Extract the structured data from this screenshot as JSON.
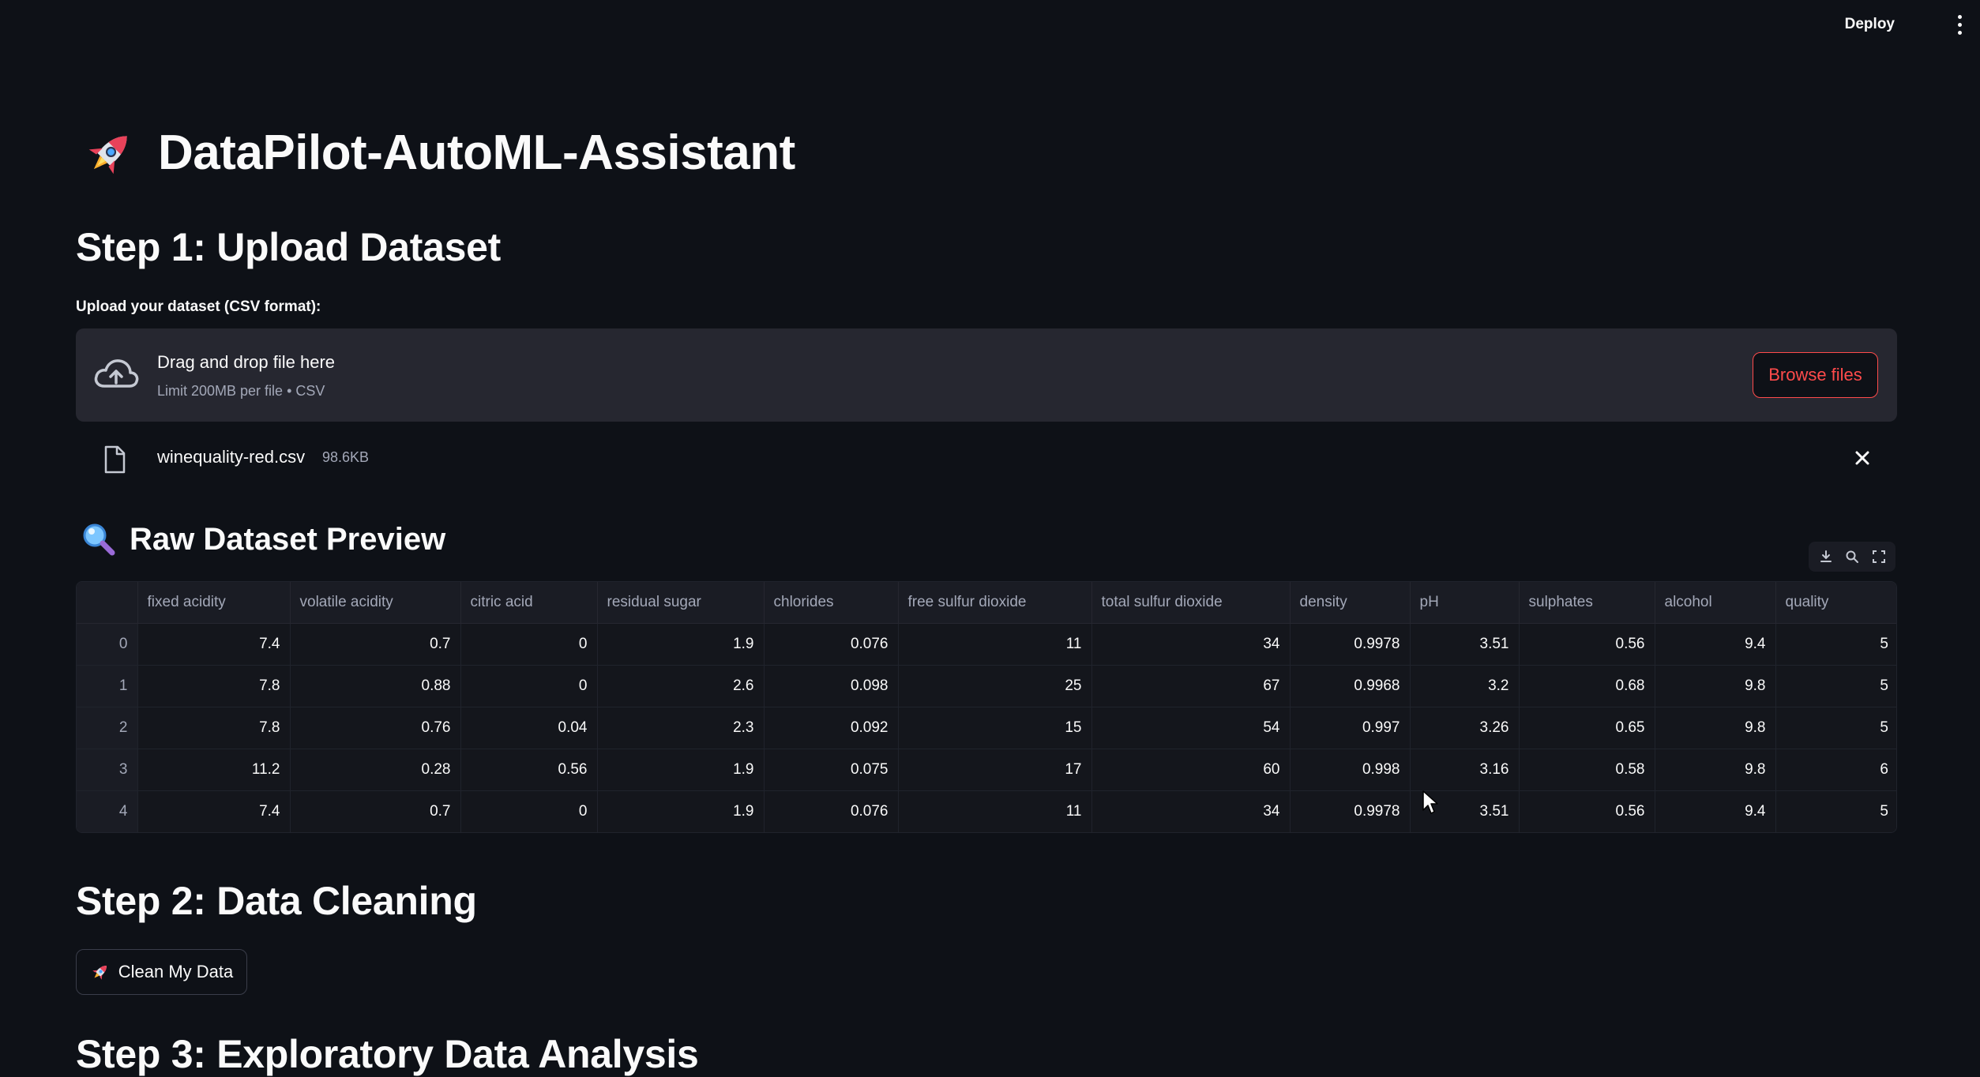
{
  "topbar": {
    "deploy_label": "Deploy",
    "menu_icon": "more-vertical-icon"
  },
  "app": {
    "title_icon": "rocket-icon",
    "title": "DataPilot-AutoML-Assistant"
  },
  "step1": {
    "heading": "Step 1: Upload Dataset",
    "upload_label": "Upload your dataset (CSV format):",
    "dropzone": {
      "icon": "cloud-upload-icon",
      "title": "Drag and drop file here",
      "subtitle": "Limit 200MB per file • CSV",
      "browse_label": "Browse files"
    },
    "uploaded_file": {
      "icon": "file-icon",
      "name": "winequality-red.csv",
      "size": "98.6KB",
      "remove_icon": "close-icon"
    }
  },
  "preview": {
    "icon": "magnifier-icon",
    "heading": "Raw Dataset Preview",
    "tools": [
      "download-icon",
      "search-icon",
      "fullscreen-icon"
    ],
    "columns": [
      "",
      "fixed acidity",
      "volatile acidity",
      "citric acid",
      "residual sugar",
      "chlorides",
      "free sulfur dioxide",
      "total sulfur dioxide",
      "density",
      "pH",
      "sulphates",
      "alcohol",
      "quality"
    ],
    "rows": [
      [
        "0",
        "7.4",
        "0.7",
        "0",
        "1.9",
        "0.076",
        "11",
        "34",
        "0.9978",
        "3.51",
        "0.56",
        "9.4",
        "5"
      ],
      [
        "1",
        "7.8",
        "0.88",
        "0",
        "2.6",
        "0.098",
        "25",
        "67",
        "0.9968",
        "3.2",
        "0.68",
        "9.8",
        "5"
      ],
      [
        "2",
        "7.8",
        "0.76",
        "0.04",
        "2.3",
        "0.092",
        "15",
        "54",
        "0.997",
        "3.26",
        "0.65",
        "9.8",
        "5"
      ],
      [
        "3",
        "11.2",
        "0.28",
        "0.56",
        "1.9",
        "0.075",
        "17",
        "60",
        "0.998",
        "3.16",
        "0.58",
        "9.8",
        "6"
      ],
      [
        "4",
        "7.4",
        "0.7",
        "0",
        "1.9",
        "0.076",
        "11",
        "34",
        "0.9978",
        "3.51",
        "0.56",
        "9.4",
        "5"
      ]
    ]
  },
  "step2": {
    "heading": "Step 2: Data Cleaning",
    "button_icon": "rocket-icon",
    "button_label": "Clean My Data"
  },
  "step3": {
    "heading": "Step 3: Exploratory Data Analysis"
  },
  "colors": {
    "background": "#0e1117",
    "surface": "#262730",
    "accent": "#ff4b4b",
    "text": "#fafafa",
    "muted": "#a3a8b8"
  }
}
